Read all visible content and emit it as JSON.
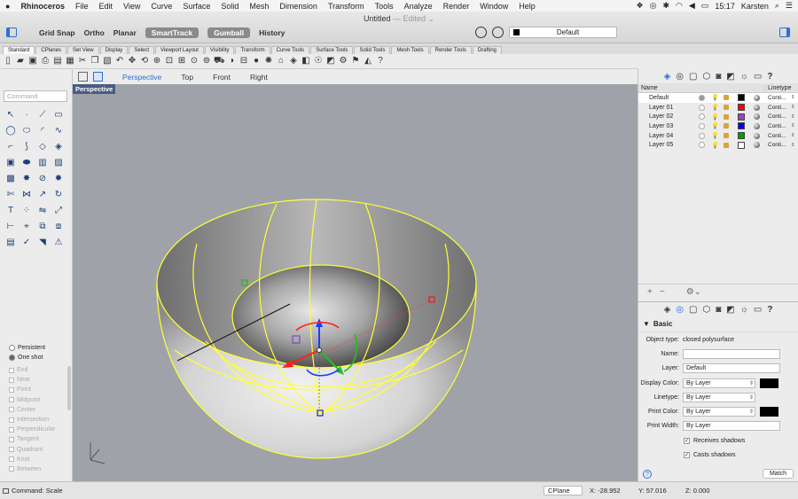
{
  "menubar": {
    "apple": "",
    "app": "Rhinoceros",
    "items": [
      "File",
      "Edit",
      "View",
      "Curve",
      "Surface",
      "Solid",
      "Mesh",
      "Dimension",
      "Transform",
      "Tools",
      "Analyze",
      "Render",
      "Window",
      "Help"
    ],
    "clock": "15:17",
    "user": "Karsten"
  },
  "window": {
    "title": "Untitled",
    "edited": "— Edited ⌄"
  },
  "modes": [
    {
      "label": "Grid Snap",
      "on": false
    },
    {
      "label": "Ortho",
      "on": false
    },
    {
      "label": "Planar",
      "on": false
    },
    {
      "label": "SmartTrack",
      "on": true
    },
    {
      "label": "Gumball",
      "on": true
    },
    {
      "label": "History",
      "on": false
    }
  ],
  "current_layer": "Default",
  "tabs": [
    "Standard",
    "CPlanes",
    "Set View",
    "Display",
    "Select",
    "Viewport Layout",
    "Visibility",
    "Transform",
    "Curve Tools",
    "Surface Tools",
    "Solid Tools",
    "Mesh Tools",
    "Render Tools",
    "Drafting"
  ],
  "viewport_tabs": [
    "Perspective",
    "Top",
    "Front",
    "Right"
  ],
  "viewport_label": "Perspective",
  "command_placeholder": "Command",
  "osnap": {
    "radios": [
      {
        "label": "Persistent",
        "on": false
      },
      {
        "label": "One shot",
        "on": true
      }
    ],
    "items": [
      "End",
      "Near",
      "Point",
      "Midpoint",
      "Center",
      "Intersection",
      "Perpendicular",
      "Tangent",
      "Quadrant",
      "Knot",
      "Between"
    ]
  },
  "layers": {
    "header_name": "Name",
    "header_linetype": "Linetype",
    "rows": [
      {
        "name": "Default",
        "color": "#000000",
        "current": true
      },
      {
        "name": "Layer 01",
        "color": "#ff0000",
        "current": false
      },
      {
        "name": "Layer 02",
        "color": "#a040c0",
        "current": false
      },
      {
        "name": "Layer 03",
        "color": "#0000ff",
        "current": false
      },
      {
        "name": "Layer 04",
        "color": "#00a000",
        "current": false
      },
      {
        "name": "Layer 05",
        "color": "#ffffff",
        "current": false
      }
    ],
    "linetype": "Conti..."
  },
  "properties": {
    "section": "Basic",
    "object_type_label": "Object type:",
    "object_type": "closed polysurface",
    "name_label": "Name:",
    "name": "",
    "layer_label": "Layer:",
    "layer": "Default",
    "display_color_label": "Display Color:",
    "display_color": "By Layer",
    "linetype_label": "Linetype:",
    "linetype": "By Layer",
    "print_color_label": "Print Color:",
    "print_color": "By Layer",
    "print_width_label": "Print Width:",
    "print_width": "By Layer",
    "receives_shadows": "Receives shadows",
    "casts_shadows": "Casts shadows",
    "match": "Match",
    "help": "?"
  },
  "status": {
    "command": "Command: Scale",
    "cplane": "CPlane",
    "x": "X: -28.952",
    "y": "Y: 57.016",
    "z": "Z: 0.000"
  }
}
